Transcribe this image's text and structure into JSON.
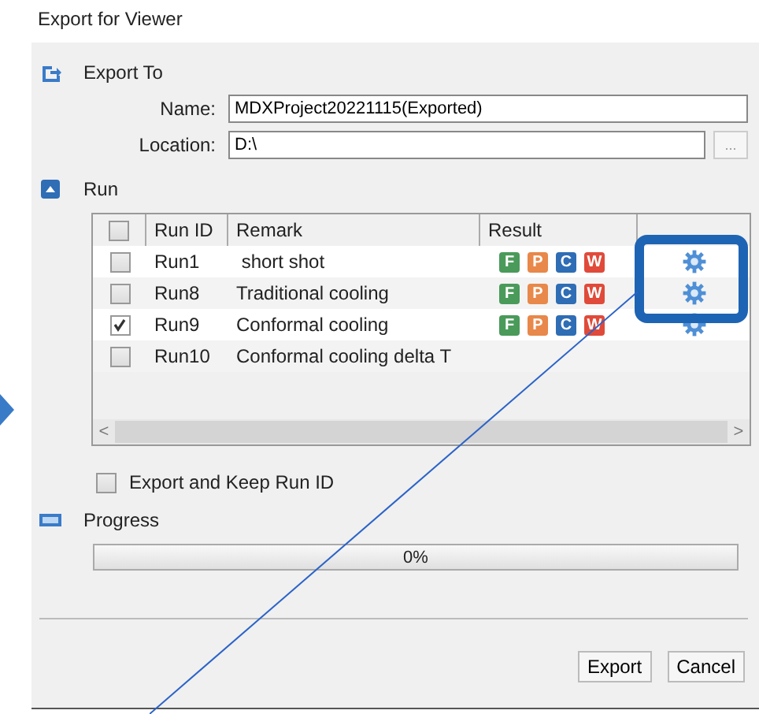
{
  "window": {
    "title": "Export for Viewer"
  },
  "export_to": {
    "heading": "Export To",
    "name_label": "Name:",
    "name_value": "MDXProject20221115(Exported)",
    "location_label": "Location:",
    "location_value": "D:\\",
    "browse_button": "..."
  },
  "run": {
    "heading": "Run",
    "select_all_checked": false,
    "columns": [
      "Run ID",
      "Remark",
      "Result"
    ],
    "rows": [
      {
        "checked": false,
        "run_id": "Run1",
        "remark": " short shot",
        "results": [
          {
            "letter": "F",
            "color": "#4a9a5a"
          },
          {
            "letter": "P",
            "color": "#e8884a"
          },
          {
            "letter": "C",
            "color": "#2f6db5"
          },
          {
            "letter": "W",
            "color": "#e04a3a"
          }
        ],
        "has_settings": true
      },
      {
        "checked": false,
        "run_id": "Run8",
        "remark": "Traditional cooling",
        "results": [
          {
            "letter": "F",
            "color": "#4a9a5a"
          },
          {
            "letter": "P",
            "color": "#e8884a"
          },
          {
            "letter": "C",
            "color": "#2f6db5"
          },
          {
            "letter": "W",
            "color": "#e04a3a"
          }
        ],
        "has_settings": true
      },
      {
        "checked": true,
        "run_id": "Run9",
        "remark": "Conformal cooling",
        "results": [
          {
            "letter": "F",
            "color": "#4a9a5a"
          },
          {
            "letter": "P",
            "color": "#e8884a"
          },
          {
            "letter": "C",
            "color": "#2f6db5"
          },
          {
            "letter": "W",
            "color": "#e04a3a"
          }
        ],
        "has_settings": true
      },
      {
        "checked": false,
        "run_id": "Run10",
        "remark": "Conformal cooling delta T",
        "has_settings": false
      }
    ],
    "scroll_left": "<",
    "scroll_right": ">"
  },
  "keep_run_id": {
    "label": "Export and Keep Run ID",
    "checked": false
  },
  "progress": {
    "heading": "Progress",
    "level": 0,
    "reading": "0%"
  },
  "buttons": [
    "Export",
    "Cancel"
  ]
}
